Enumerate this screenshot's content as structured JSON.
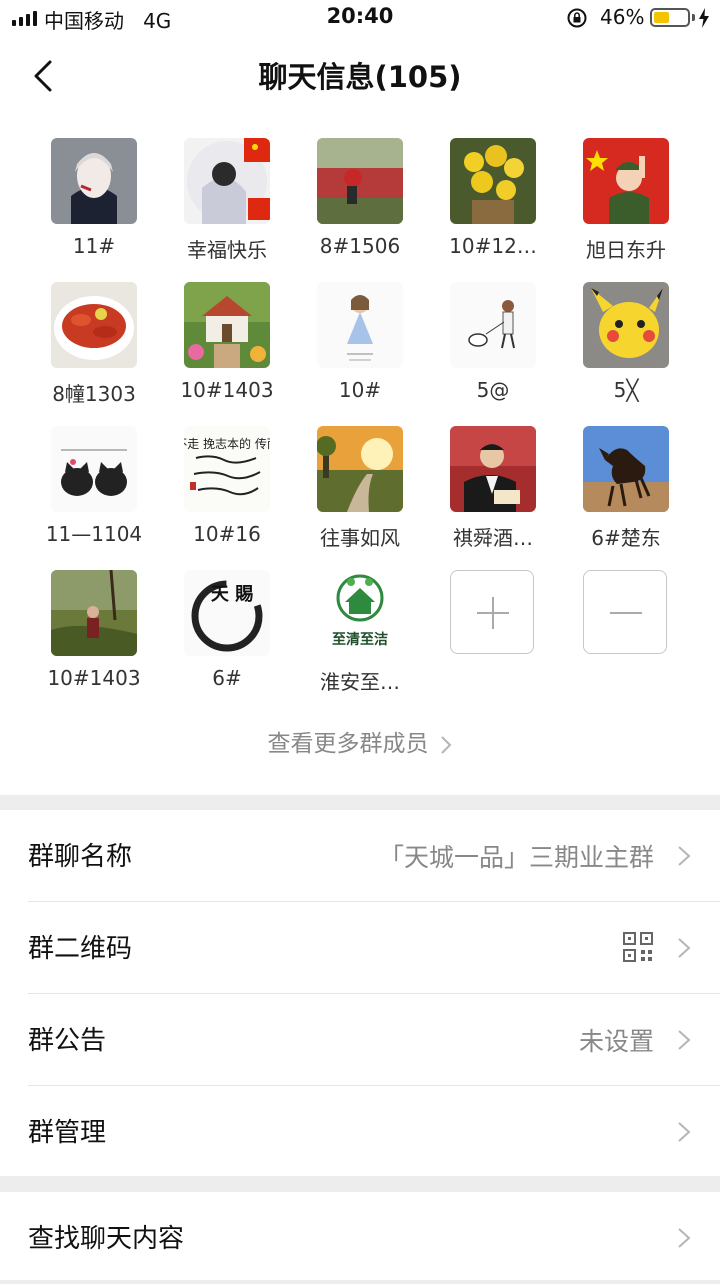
{
  "status_bar": {
    "carrier": "中国移动",
    "network": "4G",
    "time": "20:40",
    "battery": "46%",
    "battery_level": 0.46,
    "battery_color": "#f5c400"
  },
  "nav": {
    "back_icon": "chevron-left-icon",
    "title": "聊天信息(105)"
  },
  "members": [
    {
      "name": "11#"
    },
    {
      "name": "幸福快乐"
    },
    {
      "name": "8#1506"
    },
    {
      "name": "10#12…"
    },
    {
      "name": "旭日东升"
    },
    {
      "name": "8幢1303"
    },
    {
      "name": "10#1403"
    },
    {
      "name": "10#"
    },
    {
      "name": "5@"
    },
    {
      "name": "5╳"
    },
    {
      "name": "11—1104"
    },
    {
      "name": "10#16"
    },
    {
      "name": "往事如风"
    },
    {
      "name": "祺舜酒…"
    },
    {
      "name": "6#楚东"
    },
    {
      "name": "10#1403"
    },
    {
      "name": "6#"
    },
    {
      "name": "淮安至…"
    }
  ],
  "avatar_text": {
    "card_2": "佳若怡的 俊永不走 挽志本的 传而走 做生本的事",
    "card_3": "天 賜",
    "card_4": "至清至洁"
  },
  "add_member_icon": "plus-icon",
  "remove_member_icon": "minus-icon",
  "more_members": "查看更多群成员",
  "settings": {
    "group_name": {
      "label": "群聊名称",
      "value": "「天城一品」三期业主群"
    },
    "qr_code": {
      "label": "群二维码",
      "icon": "qr-code-icon"
    },
    "announcement": {
      "label": "群公告",
      "value": "未设置"
    },
    "management": {
      "label": "群管理"
    },
    "search_history": {
      "label": "查找聊天内容"
    }
  }
}
